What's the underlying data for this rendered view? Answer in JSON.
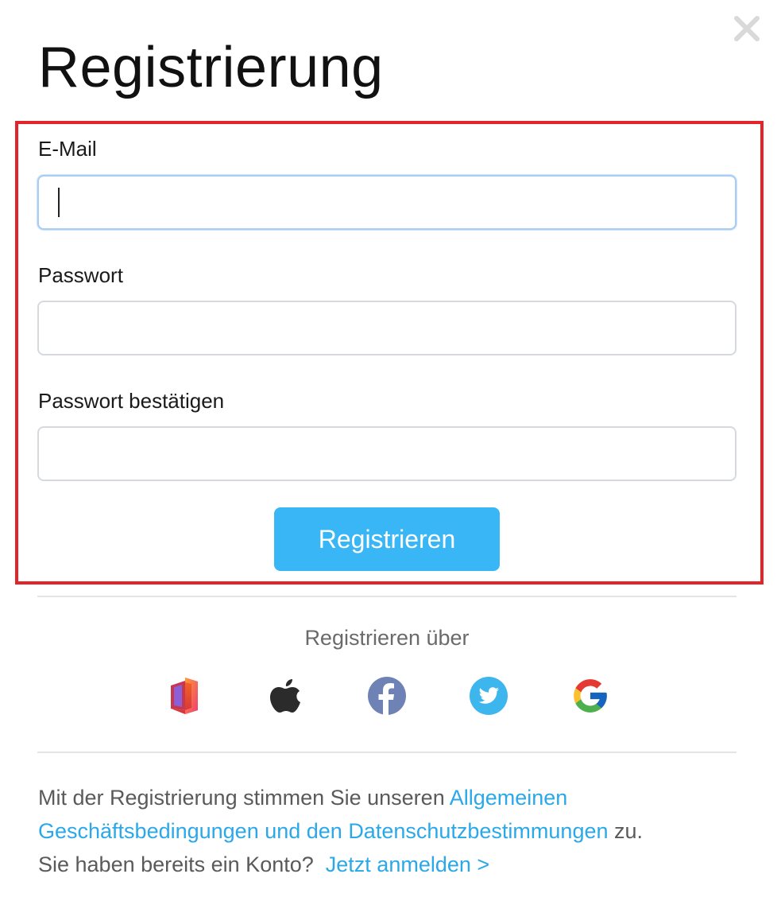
{
  "dialog": {
    "title": "Registrierung",
    "close_icon": "close-icon"
  },
  "form": {
    "email_label": "E-Mail",
    "email_value": "",
    "password_label": "Passwort",
    "password_value": "",
    "confirm_label": "Passwort bestätigen",
    "confirm_value": "",
    "submit_label": "Registrieren"
  },
  "social": {
    "heading": "Registrieren über",
    "providers": [
      {
        "name": "Office",
        "icon": "office-icon"
      },
      {
        "name": "Apple",
        "icon": "apple-icon"
      },
      {
        "name": "Facebook",
        "icon": "facebook-icon"
      },
      {
        "name": "Twitter",
        "icon": "twitter-icon"
      },
      {
        "name": "Google",
        "icon": "google-icon"
      }
    ]
  },
  "footer": {
    "terms_prefix": "Mit der Registrierung stimmen Sie unseren ",
    "terms_link": "Allgemeinen Geschäftsbedingungen und den Datenschutzbestimmungen",
    "terms_suffix": " zu.",
    "login_prompt": "Sie haben bereits ein Konto?",
    "login_link": "Jetzt anmelden >"
  },
  "colors": {
    "accent": "#38b6f5",
    "link": "#2aa8e8",
    "highlight": "#e3242b",
    "facebook": "#6e82b5",
    "twitter": "#3db6ee"
  }
}
